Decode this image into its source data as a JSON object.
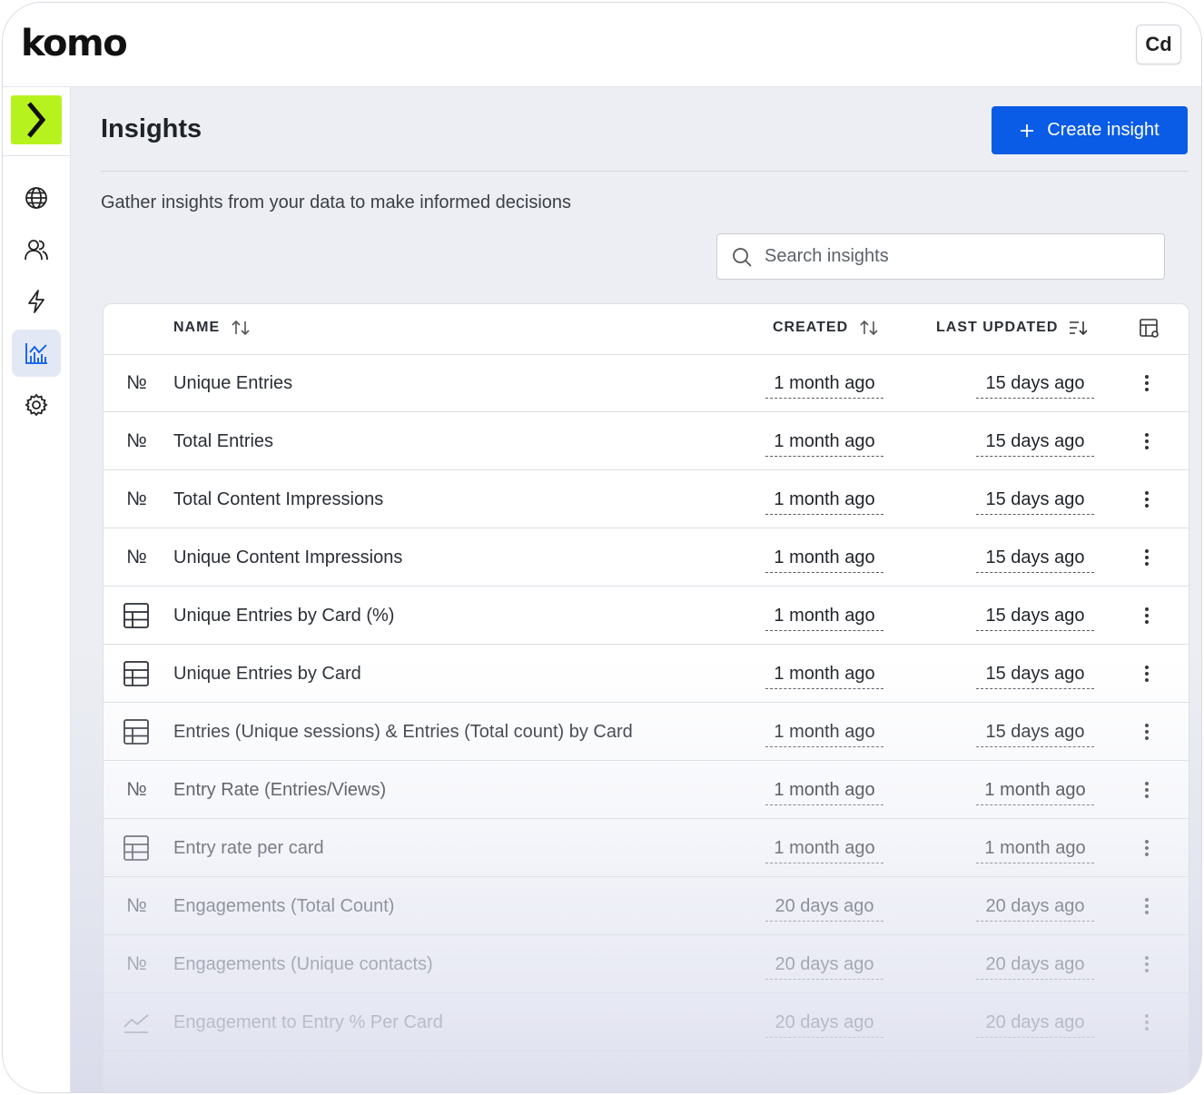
{
  "app": {
    "logo_text": "komo",
    "user_initials": "Cd"
  },
  "sidebar": {
    "items": [
      {
        "icon": "globe-icon",
        "active": false
      },
      {
        "icon": "users-icon",
        "active": false
      },
      {
        "icon": "lightning-icon",
        "active": false
      },
      {
        "icon": "chart-icon",
        "active": true
      },
      {
        "icon": "gear-icon",
        "active": false
      }
    ]
  },
  "page": {
    "title": "Insights",
    "subtitle": "Gather insights from your data to make informed decisions",
    "create_button_label": "Create insight",
    "search_placeholder": "Search insights"
  },
  "table": {
    "columns": {
      "name": "NAME",
      "created": "CREATED",
      "last_updated": "LAST UPDATED"
    },
    "rows": [
      {
        "type": "number",
        "name": "Unique Entries",
        "created": "1 month ago",
        "updated": "15 days ago"
      },
      {
        "type": "number",
        "name": "Total Entries",
        "created": "1 month ago",
        "updated": "15 days ago"
      },
      {
        "type": "number",
        "name": "Total Content Impressions",
        "created": "1 month ago",
        "updated": "15 days ago"
      },
      {
        "type": "number",
        "name": "Unique Content Impressions",
        "created": "1 month ago",
        "updated": "15 days ago"
      },
      {
        "type": "table",
        "name": "Unique Entries by Card (%)",
        "created": "1 month ago",
        "updated": "15 days ago"
      },
      {
        "type": "table",
        "name": "Unique Entries by Card",
        "created": "1 month ago",
        "updated": "15 days ago"
      },
      {
        "type": "table",
        "name": "Entries (Unique sessions) & Entries (Total count) by Card",
        "created": "1 month ago",
        "updated": "15 days ago"
      },
      {
        "type": "number",
        "name": "Entry Rate (Entries/Views)",
        "created": "1 month ago",
        "updated": "1 month ago"
      },
      {
        "type": "table",
        "name": "Entry rate per card",
        "created": "1 month ago",
        "updated": "1 month ago"
      },
      {
        "type": "number",
        "name": "Engagements (Total Count)",
        "created": "20 days ago",
        "updated": "20 days ago"
      },
      {
        "type": "number",
        "name": "Engagements (Unique contacts)",
        "created": "20 days ago",
        "updated": "20 days ago"
      },
      {
        "type": "line",
        "name": "Engagement to Entry % Per Card",
        "created": "20 days ago",
        "updated": "20 days ago"
      }
    ],
    "number_type_glyph": "№"
  },
  "colors": {
    "accent": "#0a5ce6",
    "brand": "#b6f31e",
    "active_nav_bg": "#e3e8f5"
  }
}
